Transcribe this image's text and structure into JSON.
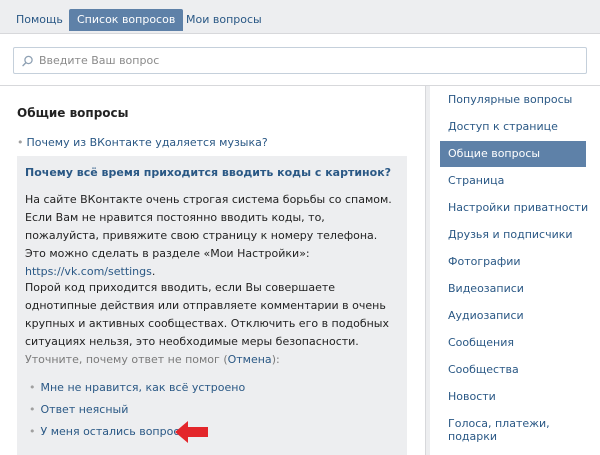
{
  "tabs": [
    {
      "label": "Помощь",
      "active": false
    },
    {
      "label": "Список вопросов",
      "active": true
    },
    {
      "label": "Мои вопросы",
      "active": false
    }
  ],
  "search": {
    "placeholder": "Введите Ваш вопрос"
  },
  "main": {
    "title": "Общие вопросы",
    "question_link": "Почему из ВКонтакте удаляется музыка?",
    "answer": {
      "title": "Почему всё время приходится вводить коды с картинок?",
      "p1_text": "На сайте ВКонтакте очень строгая система борьбы со спамом. Если Вам не нравится постоянно вводить коды, то, пожалуйста, привяжите свою страницу к номеру телефона. Это можно сделать в разделе «Мои Настройки»: ",
      "p1_link": "https://vk.com/settings",
      "p1_end": ".",
      "p2": "Порой код приходится вводить, если Вы совершаете однотипные действия или отправляете комментарии в очень крупных и активных сообществах. Отключить его в подобных ситуациях нельзя, это необходимые меры безопасности.",
      "clarify_text": "Уточните, почему ответ не помог (",
      "clarify_cancel": "Отмена",
      "clarify_end": "):",
      "options": [
        "Мне не нравится, как всё устроено",
        "Ответ неясный",
        "У меня остались вопросы"
      ]
    }
  },
  "sidebar": {
    "items": [
      {
        "label": "Популярные вопросы",
        "active": false
      },
      {
        "label": "Доступ к странице",
        "active": false
      },
      {
        "label": "Общие вопросы",
        "active": true
      },
      {
        "label": "Страница",
        "active": false
      },
      {
        "label": "Настройки приватности",
        "active": false
      },
      {
        "label": "Друзья и подписчики",
        "active": false
      },
      {
        "label": "Фотографии",
        "active": false
      },
      {
        "label": "Видеозаписи",
        "active": false
      },
      {
        "label": "Аудиозаписи",
        "active": false
      },
      {
        "label": "Сообщения",
        "active": false
      },
      {
        "label": "Сообщества",
        "active": false
      },
      {
        "label": "Новости",
        "active": false
      },
      {
        "label": "Голоса, платежи, подарки",
        "active": false
      }
    ]
  },
  "colors": {
    "accent": "#5e81a8",
    "link": "#2a5885",
    "arrow": "#e3262b",
    "background": "#edeef0"
  }
}
